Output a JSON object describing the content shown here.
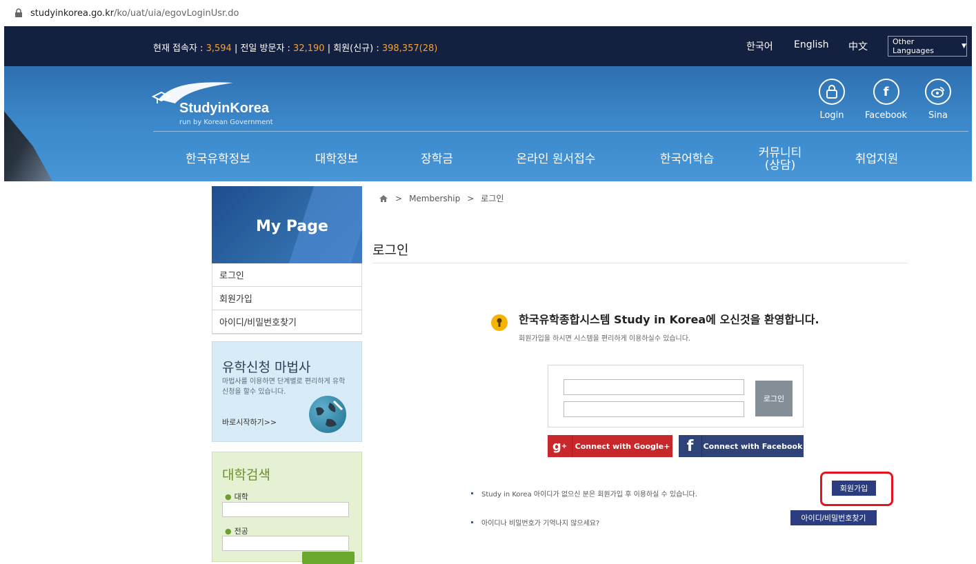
{
  "browser": {
    "url_host": "studyinkorea.go.kr",
    "url_path": "/ko/uat/uia/egovLoginUsr.do"
  },
  "topbar": {
    "stats": {
      "current_label": "현재 접속자 : ",
      "current_value": "3,594",
      "yesterday_label": "전일 방문자 : ",
      "yesterday_value": "32,190",
      "members_label": "회원(신규) : ",
      "members_value": "398,357(28)"
    },
    "languages": [
      "한국어",
      "English",
      "中文"
    ],
    "other_languages": "Other Languages"
  },
  "brand": {
    "name": "StudyinKorea",
    "tagline": "run by Korean Government"
  },
  "social": [
    {
      "label": "Login",
      "icon": "lock-icon"
    },
    {
      "label": "Facebook",
      "icon": "facebook-icon"
    },
    {
      "label": "Sina",
      "icon": "weibo-icon"
    }
  ],
  "main_nav": [
    {
      "label": "한국유학정보"
    },
    {
      "label": "대학정보"
    },
    {
      "label": "장학금"
    },
    {
      "label": "온라인 원서접수"
    },
    {
      "label": "한국어학습"
    },
    {
      "label": "커뮤니티\n(상담)"
    },
    {
      "label": "취업지원"
    }
  ],
  "sidebar": {
    "title": "My Page",
    "menu": [
      "로그인",
      "회원가입",
      "아이디/비밀번호찾기"
    ],
    "wizard": {
      "title": "유학신청 마법사",
      "desc": "마법사를 이용하면 단계별로 편리하게 유학신청을 할수 있습니다.",
      "link": "바로시작하기>>"
    },
    "uni_search": {
      "title": "대학검색",
      "university_label": "대학",
      "major_label": "전공"
    }
  },
  "breadcrumb": [
    "Membership",
    "로그인"
  ],
  "page_title": "로그인",
  "welcome": {
    "heading": "한국유학종합시스템 Study in Korea에 오신것을 환영합니다.",
    "sub": "회원가입을 하시면 시스템을 편리하게 이용하실수 있습니다."
  },
  "login_form": {
    "button": "로그인"
  },
  "social_login": {
    "google": "Connect with Google+",
    "facebook": "Connect with Facebook"
  },
  "notes": {
    "join_text": "Study in Korea 아이디가 없으신 분은 회원가입 후 이용하실 수 있습니다.",
    "join_button": "회원가입",
    "find_text": "아이디나 비밀번호가 기억나지 않으세요?",
    "find_button": "아이디/비밀번호찾기"
  },
  "colors": {
    "topbar": "#14203f",
    "accent_number": "#f2a33a",
    "button_navy": "#2b3d7e",
    "highlight": "#e4141f",
    "google_red": "#c8282b"
  }
}
